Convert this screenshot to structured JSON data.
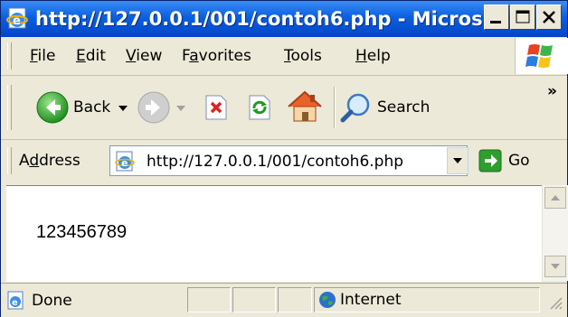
{
  "window": {
    "title": "http://127.0.0.1/001/contoh6.php - Micros..."
  },
  "menu": {
    "items": [
      {
        "prefix": "",
        "ul": "F",
        "rest": "ile"
      },
      {
        "prefix": "",
        "ul": "E",
        "rest": "dit"
      },
      {
        "prefix": "",
        "ul": "V",
        "rest": "iew"
      },
      {
        "prefix": "F",
        "ul": "a",
        "rest": "vorites"
      },
      {
        "prefix": "",
        "ul": "T",
        "rest": "ools"
      },
      {
        "prefix": "",
        "ul": "H",
        "rest": "elp"
      }
    ]
  },
  "toolbar": {
    "back_label": "Back",
    "search_label": "Search",
    "chevron": "»"
  },
  "address": {
    "label_prefix": "A",
    "label_ul": "d",
    "label_rest": "dress",
    "url": "http://127.0.0.1/001/contoh6.php",
    "go_label": "Go"
  },
  "content": {
    "text": "123456789"
  },
  "status": {
    "text": "Done",
    "zone": "Internet"
  },
  "icons": {
    "title": "ie-page-icon",
    "back": "back-arrow-icon",
    "forward": "forward-arrow-icon",
    "stop": "stop-icon",
    "refresh": "refresh-icon",
    "home": "home-icon",
    "search": "search-icon",
    "windows": "windows-logo-icon",
    "globe": "globe-icon"
  },
  "colors": {
    "title_bar": "#0a5fe0",
    "chrome": "#ece9d8",
    "go_green": "#2e9e2e"
  }
}
